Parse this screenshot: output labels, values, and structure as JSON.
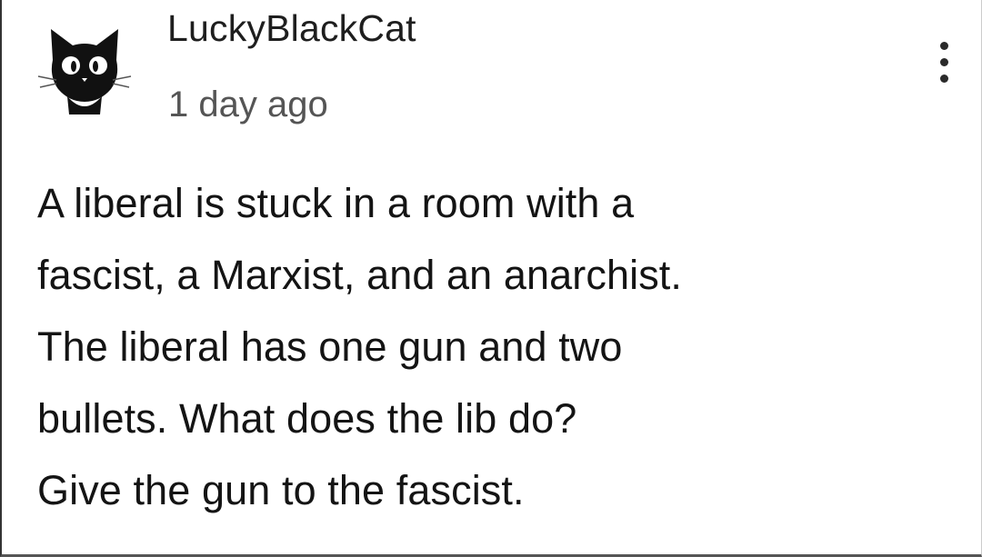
{
  "comment": {
    "author": "LuckyBlackCat",
    "timestamp": "1 day ago",
    "avatar_icon": "black-cat-icon",
    "menu_icon": "more-vertical-icon",
    "lines": [
      "A liberal is stuck in a room with a",
      "fascist, a Marxist, and an anarchist.",
      "The liberal has one gun and two",
      "bullets. What does the lib do?",
      "Give the gun to the fascist."
    ]
  }
}
